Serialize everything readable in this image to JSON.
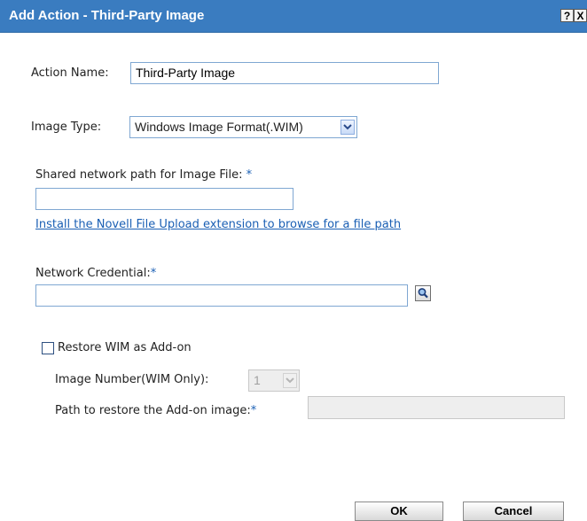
{
  "dialog": {
    "title": "Add Action - Third-Party Image",
    "help_label": "?",
    "close_label": "X"
  },
  "form": {
    "action_name": {
      "label": "Action Name:",
      "value": "Third-Party Image"
    },
    "image_type": {
      "label": "Image Type:",
      "selected": "Windows Image Format(.WIM)"
    },
    "shared_path": {
      "label": "Shared network path for Image File:",
      "required": "*",
      "value": ""
    },
    "upload_link": "Install the Novell File Upload extension to browse for a file path",
    "credential": {
      "label": "Network Credential:",
      "required": "*",
      "value": ""
    },
    "restore_addon": {
      "label": "Restore WIM as Add-on",
      "checked": false
    },
    "image_number": {
      "label": "Image Number(WIM Only):",
      "selected": "1"
    },
    "addon_path": {
      "label": "Path to restore the Add-on image:",
      "required": "*",
      "value": ""
    }
  },
  "buttons": {
    "ok": "OK",
    "cancel": "Cancel"
  },
  "icons": {
    "arrow": "chevron-down-icon",
    "lookup": "search-icon"
  }
}
